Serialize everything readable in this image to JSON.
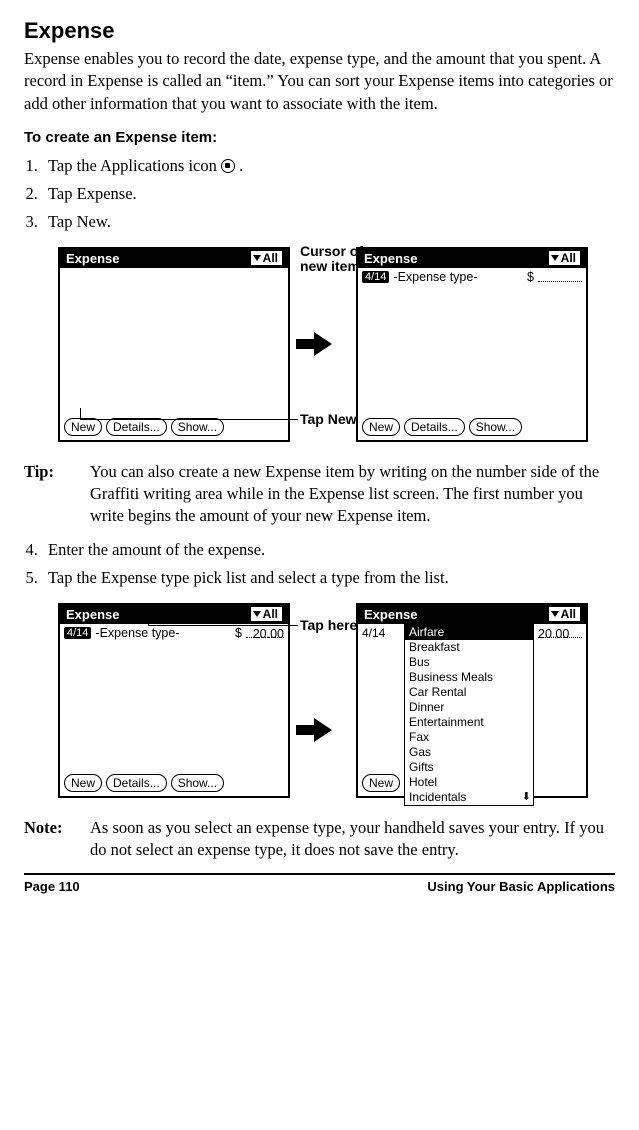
{
  "heading": "Expense",
  "intro": "Expense enables you to record the date, expense type, and the amount that you spent. A record in Expense is called an “item.” You can sort your Expense items into categories or add other information that you want to associate with the item.",
  "subhead": "To create an Expense item:",
  "steps123": {
    "s1a": "Tap the Applications icon ",
    "s1b": " .",
    "s2": "Tap Expense.",
    "s3": "Tap New."
  },
  "palm": {
    "title": "Expense",
    "category": "All",
    "date": "4/14",
    "typePlaceholder": "-Expense type-",
    "currency": "$",
    "amount": "20.00",
    "buttons": {
      "new": "New",
      "details": "Details...",
      "show": "Show..."
    }
  },
  "callouts": {
    "cursor": "Cursor of new item",
    "tapnew": "Tap New",
    "taphere": "Tap here"
  },
  "tip": {
    "label": "Tip:",
    "body": "You can also create a new Expense item by writing on the number side of the Graffiti writing area while in the Expense list screen. The first number you write begins the amount of your new Expense item."
  },
  "steps45": {
    "s4": "Enter the amount of the expense.",
    "s5": "Tap the Expense type pick list and select a type from the list."
  },
  "typeList": [
    "Airfare",
    "Breakfast",
    "Bus",
    "Business Meals",
    "Car Rental",
    "Dinner",
    "Entertainment",
    "Fax",
    "Gas",
    "Gifts",
    "Hotel",
    "Incidentals"
  ],
  "note": {
    "label": "Note:",
    "body": "As soon as you select an expense type, your handheld saves your entry. If you do not select an expense type, it does not save the entry."
  },
  "footer": {
    "left": "Page 110",
    "right": "Using Your Basic Applications"
  }
}
